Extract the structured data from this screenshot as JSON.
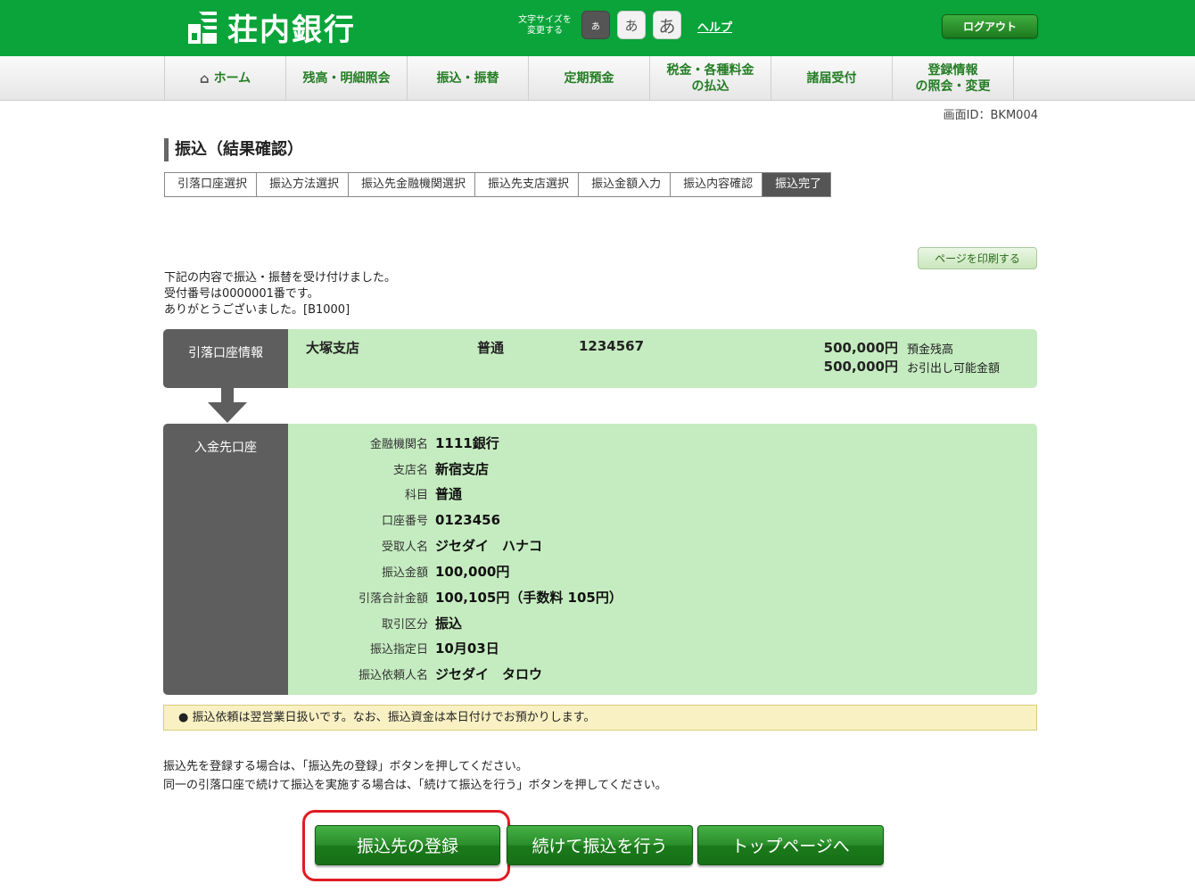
{
  "header": {
    "logo_text": "荘内銀行",
    "font_size_label": "文字サイズを\n変更する",
    "font_sizes": [
      "あ",
      "あ",
      "あ"
    ],
    "help": "ヘルプ",
    "logout": "ログアウト"
  },
  "nav": {
    "items": [
      "ホーム",
      "残高・明細照会",
      "振込・振替",
      "定期預金",
      "税金・各種料金\nの払込",
      "諸届受付",
      "登録情報\nの照会・変更"
    ]
  },
  "screen_id": "画面ID：BKM004",
  "page_title": "振込（結果確認）",
  "steps": [
    "引落口座選択",
    "振込方法選択",
    "振込先金融機関選択",
    "振込先支店選択",
    "振込金額入力",
    "振込内容確認",
    "振込完了"
  ],
  "print_button": "ページを印刷する",
  "message": {
    "line1": "下記の内容で振込・振替を受け付けました。",
    "line2": "受付番号は0000001番です。",
    "line3": "ありがとうございました。[B1000]"
  },
  "source": {
    "label": "引落口座情報",
    "branch": "大塚支店",
    "type": "普通",
    "number": "1234567",
    "balance": "500,000円",
    "balance_label": "預金残高",
    "available": "500,000円",
    "available_label": "お引出し可能金額"
  },
  "destination": {
    "label": "入金先口座",
    "rows": [
      {
        "k": "金融機関名",
        "v": "1111銀行"
      },
      {
        "k": "支店名",
        "v": "新宿支店"
      },
      {
        "k": "科目",
        "v": "普通"
      },
      {
        "k": "口座番号",
        "v": "0123456"
      },
      {
        "k": "受取人名",
        "v": "ジセダイ　ハナコ"
      },
      {
        "k": "振込金額",
        "v": "100,000円"
      },
      {
        "k": "引落合計金額",
        "v": "100,105円（手数料 105円）"
      },
      {
        "k": "取引区分",
        "v": "振込"
      },
      {
        "k": "振込指定日",
        "v": "10月03日"
      },
      {
        "k": "振込依頼人名",
        "v": "ジセダイ　タロウ"
      }
    ]
  },
  "notice": "●  振込依頼は翌営業日扱いです。なお、振込資金は本日付けでお預かりします。",
  "guide": {
    "line1": "振込先を登録する場合は、「振込先の登録」ボタンを押してください。",
    "line2": "同一の引落口座で続けて振込を実施する場合は、「続けて振込を行う」ボタンを押してください。"
  },
  "buttons": {
    "register": "振込先の登録",
    "continue": "続けて振込を行う",
    "top": "トップページへ"
  }
}
